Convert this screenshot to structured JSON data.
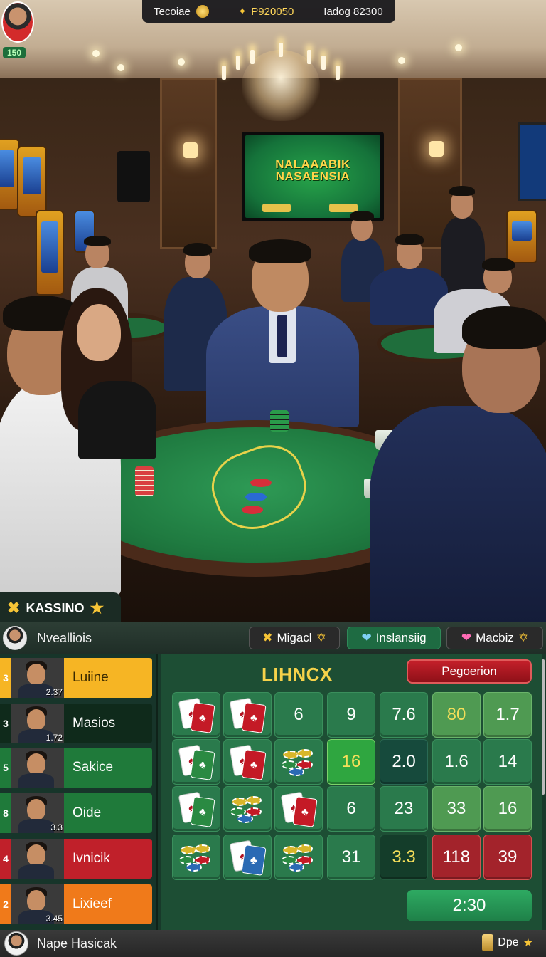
{
  "scene": {
    "tv_title": "NALAAABIK\nNASAENSIA"
  },
  "topbar": {
    "avatar_level": "150",
    "left_label": "Tecoiae",
    "coins": "P920050",
    "right_label": "Iadog 82300"
  },
  "tab": {
    "label": "KASSINO"
  },
  "header": {
    "player_name": "Nvealliois",
    "buttons": [
      {
        "label": "Migacl",
        "icon": "trophy-icon"
      },
      {
        "label": "Inslansiig",
        "icon": "heart-icon",
        "color": "#3ab0e8"
      },
      {
        "label": "Macbiz",
        "icon": "heart-icon",
        "color": "#ff5aa8"
      }
    ]
  },
  "sidebar": {
    "players": [
      {
        "rank": "3",
        "score": "2.37",
        "name": "Luiine",
        "color": "#f6b524"
      },
      {
        "rank": "3",
        "score": "1.72",
        "name": "Masios",
        "color": "#0f2a1b"
      },
      {
        "rank": "5",
        "score": "",
        "name": "Sakice",
        "color": "#1f7a3a"
      },
      {
        "rank": "8",
        "score": "3.3",
        "name": "Oide",
        "color": "#1f7a3a"
      },
      {
        "rank": "4",
        "score": "",
        "name": "Ivnicik",
        "color": "#c0202a"
      },
      {
        "rank": "2",
        "score": "3.45",
        "name": "Lixieef",
        "color": "#f07a1a"
      }
    ]
  },
  "board": {
    "title": "LIHNCX",
    "pref_button": "Pegoerion",
    "timer": "2:30",
    "rows": [
      [
        {
          "kind": "cards",
          "icon": "playing-cards-icon",
          "back": "red"
        },
        {
          "kind": "cards",
          "icon": "playing-cards-icon",
          "back": "red"
        },
        {
          "kind": "value",
          "value": "6",
          "style": "c-green"
        },
        {
          "kind": "value",
          "value": "9",
          "style": "c-green"
        },
        {
          "kind": "value",
          "value": "7.6",
          "style": "c-green"
        },
        {
          "kind": "value",
          "value": "80",
          "style": "c-light c-yellowtext"
        },
        {
          "kind": "value",
          "value": "1.7",
          "style": "c-light"
        }
      ],
      [
        {
          "kind": "cards",
          "icon": "playing-cards-icon",
          "back": "green"
        },
        {
          "kind": "cards",
          "icon": "playing-cards-icon",
          "back": "red"
        },
        {
          "kind": "chips",
          "icon": "chip-stack-icon"
        },
        {
          "kind": "value",
          "value": "16",
          "style": "c-bright"
        },
        {
          "kind": "value",
          "value": "2.0",
          "style": "c-teal"
        },
        {
          "kind": "value",
          "value": "1.6",
          "style": "c-green"
        },
        {
          "kind": "value",
          "value": "14",
          "style": "c-green"
        }
      ],
      [
        {
          "kind": "cards",
          "icon": "playing-cards-icon",
          "back": "green"
        },
        {
          "kind": "chips",
          "icon": "chip-stack-icon"
        },
        {
          "kind": "cards",
          "icon": "playing-cards-icon",
          "back": "red"
        },
        {
          "kind": "value",
          "value": "6",
          "style": "c-green"
        },
        {
          "kind": "value",
          "value": "23",
          "style": "c-green"
        },
        {
          "kind": "value",
          "value": "33",
          "style": "c-light"
        },
        {
          "kind": "value",
          "value": "16",
          "style": "c-light"
        }
      ],
      [
        {
          "kind": "chips",
          "icon": "chip-stack-icon"
        },
        {
          "kind": "cards",
          "icon": "playing-cards-icon",
          "back": "blue"
        },
        {
          "kind": "chips",
          "icon": "chip-stack-icon"
        },
        {
          "kind": "value",
          "value": "31",
          "style": "c-green"
        },
        {
          "kind": "value",
          "value": "3.3",
          "style": "c-dark c-yellowtext"
        },
        {
          "kind": "value",
          "value": "118",
          "style": "c-red"
        },
        {
          "kind": "value",
          "value": "39",
          "style": "c-red"
        }
      ]
    ]
  },
  "bottom": {
    "player_name": "Nape Hasicak",
    "right_label": "Dpe"
  }
}
